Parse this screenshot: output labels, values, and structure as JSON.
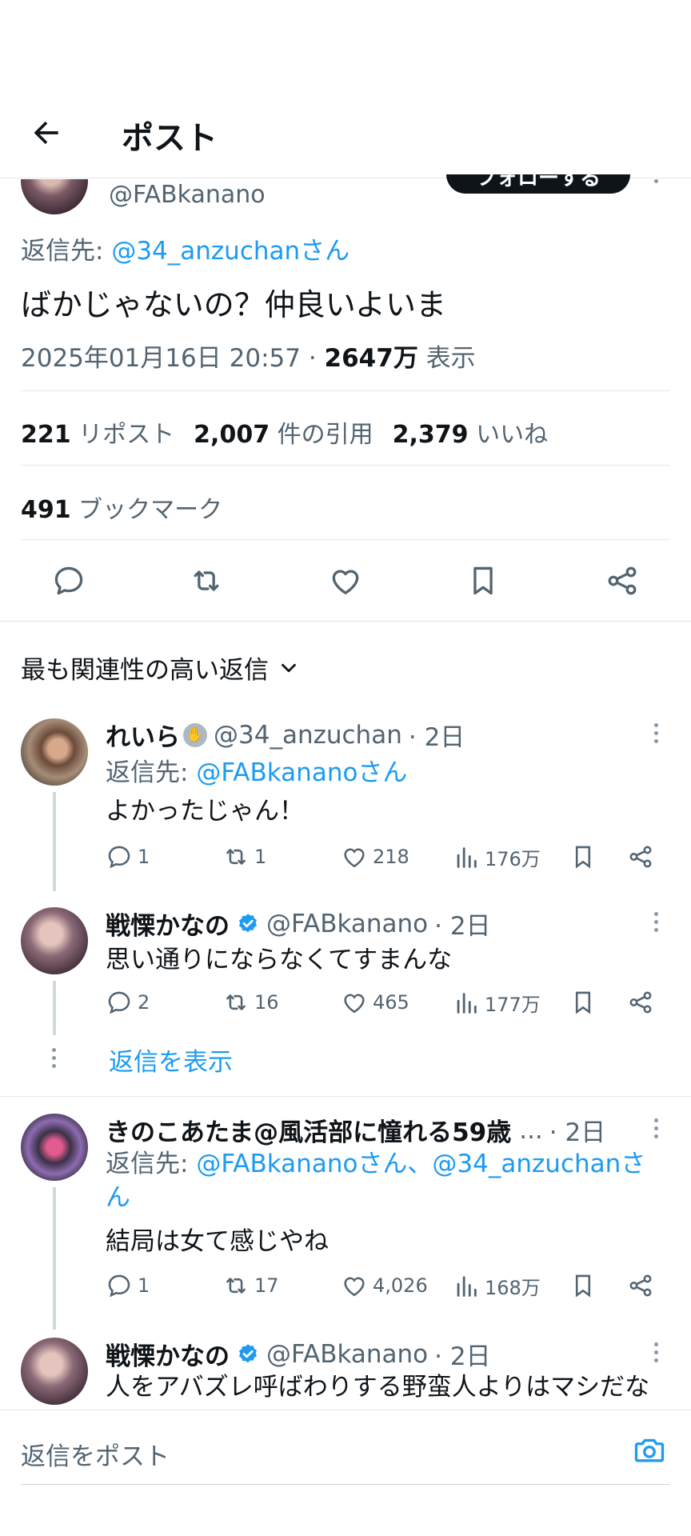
{
  "header": {
    "title": "ポスト"
  },
  "main_post": {
    "handle": "@FABkanano",
    "follow_label": "フォローする",
    "reply_to_prefix": "返信先:",
    "reply_to": "@34_anzuchanさん",
    "text": "ばかじゃないの？仲良いよいま",
    "timestamp": "2025年01月16日 20:57 ·",
    "views_count": "2647万",
    "views_label": "表示",
    "reposts_count": "221",
    "reposts_label": "リポスト",
    "quotes_count": "2,007",
    "quotes_label": "件の引用",
    "likes_count": "2,379",
    "likes_label": "いいね",
    "bookmarks_count": "491",
    "bookmarks_label": "ブックマーク"
  },
  "sort": {
    "label": "最も関連性の高い返信"
  },
  "replies": [
    {
      "name": "れいら",
      "handle": "@34_anzuchan",
      "time": "· 2日",
      "reply_to_prefix": "返信先:",
      "reply_to": "@FABkananoさん",
      "text": "よかったじゃん！",
      "replies": "1",
      "reposts": "1",
      "likes": "218",
      "views": "176万"
    },
    {
      "name": "戦慄かなの",
      "handle": "@FABkanano",
      "time": "· 2日",
      "text": "思い通りにならなくてすまんな",
      "replies": "2",
      "reposts": "16",
      "likes": "465",
      "views": "177万",
      "show_replies": "返信を表示"
    },
    {
      "name": "きのこあたま@風活部に憧れる59歳",
      "ellipsis": "...",
      "time": "· 2日",
      "reply_to_prefix": "返信先:",
      "reply_to_line1": "@FABkananoさん、@34_anzuchanさ",
      "reply_to_line2": "ん",
      "text": "結局は女て感じやね",
      "replies": "1",
      "reposts": "17",
      "likes": "4,026",
      "views": "168万"
    },
    {
      "name": "戦慄かなの",
      "handle": "@FABkanano",
      "time": "· 2日",
      "text": "人をアバズレ呼ばわりする野蛮人よりはマシだな"
    }
  ],
  "composer": {
    "placeholder": "返信をポスト"
  },
  "colors": {
    "accent": "#1d9bf0",
    "text": "#0f1419",
    "secondary": "#536471",
    "divider": "#e3e7ea"
  }
}
